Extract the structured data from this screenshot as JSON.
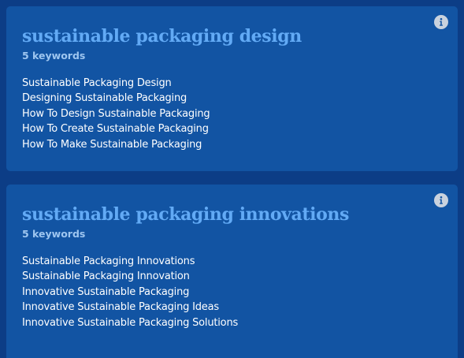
{
  "cards": [
    {
      "title": "sustainable packaging design",
      "count_label": "5 keywords",
      "keywords": [
        "Sustainable Packaging Design",
        "Designing Sustainable Packaging",
        "How To Design Sustainable Packaging",
        "How To Create Sustainable Packaging",
        "How To Make Sustainable Packaging"
      ],
      "info_icon": "info-icon"
    },
    {
      "title": "sustainable packaging innovations",
      "count_label": "5 keywords",
      "keywords": [
        "Sustainable Packaging Innovations",
        "Sustainable Packaging Innovation",
        "Innovative Sustainable Packaging",
        "Innovative Sustainable Packaging Ideas",
        "Innovative Sustainable Packaging Solutions"
      ],
      "info_icon": "info-icon"
    }
  ],
  "colors": {
    "page_background": "#0c3d86",
    "card_background": "#1254a3",
    "title": "#62aaf5",
    "count": "#9ec6f0",
    "keyword": "#ffffff",
    "info_icon_fill": "#c9d2de"
  }
}
